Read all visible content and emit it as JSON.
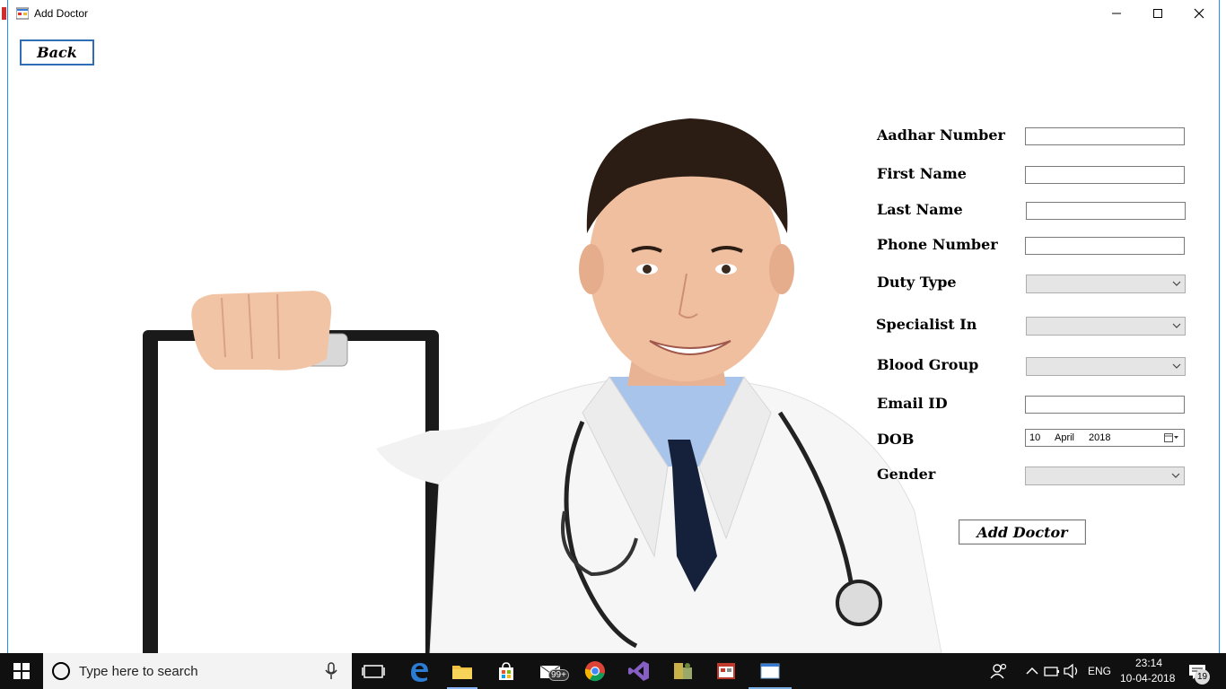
{
  "window": {
    "title": "Add Doctor"
  },
  "back_button": {
    "label": "Back"
  },
  "form": {
    "fields": [
      {
        "label": "Aadhar Number",
        "type": "text",
        "value": ""
      },
      {
        "label": "First Name",
        "type": "text",
        "value": ""
      },
      {
        "label": "Last Name",
        "type": "text",
        "value": ""
      },
      {
        "label": "Phone Number",
        "type": "text",
        "value": ""
      },
      {
        "label": "Duty Type",
        "type": "select",
        "value": ""
      },
      {
        "label": "Specialist In",
        "type": "select",
        "value": ""
      },
      {
        "label": "Blood Group",
        "type": "select",
        "value": ""
      },
      {
        "label": "Email ID",
        "type": "text",
        "value": ""
      },
      {
        "label": "DOB",
        "type": "date",
        "day": "10",
        "month": "April",
        "year": "2018"
      },
      {
        "label": "Gender",
        "type": "select",
        "value": ""
      }
    ],
    "submit_label": "Add Doctor"
  },
  "taskbar": {
    "search_placeholder": "Type here to search",
    "mail_badge": "99+",
    "language": "ENG",
    "time": "23:14",
    "date": "10-04-2018",
    "notification_count": "19",
    "icons": [
      "windows-start-icon",
      "cortana-icon",
      "microphone-icon",
      "task-view-icon",
      "edge-icon",
      "file-explorer-icon",
      "store-icon",
      "mail-icon",
      "chrome-icon",
      "visual-studio-icon",
      "sql-tools-icon",
      "app-icon",
      "window-app-icon",
      "people-icon",
      "chevron-up-icon",
      "network-icon",
      "volume-icon",
      "action-center-icon"
    ]
  }
}
